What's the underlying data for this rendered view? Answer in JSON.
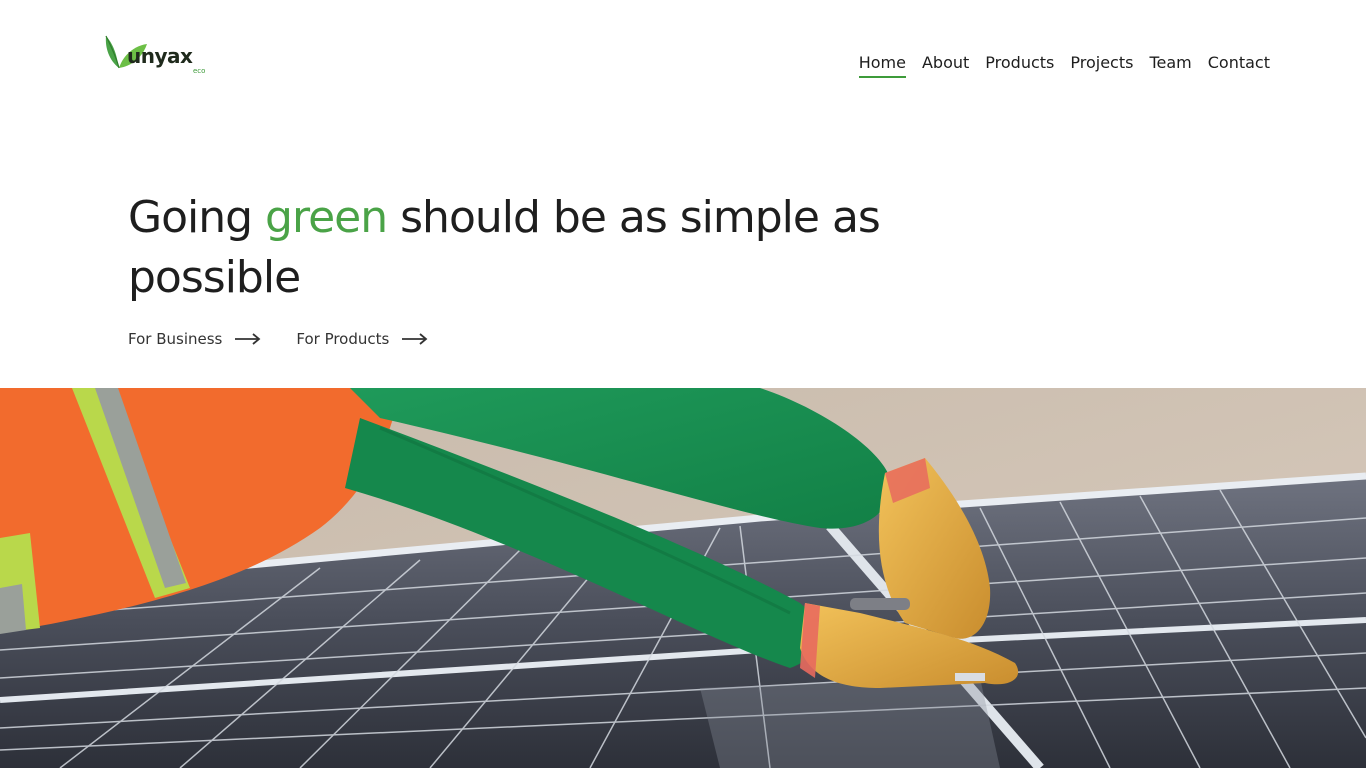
{
  "brand": {
    "name": "unyax",
    "sub": "eco",
    "colors": {
      "primary": "#4aa347",
      "text": "#1e1e1e"
    }
  },
  "nav": {
    "items": [
      {
        "label": "Home",
        "active": true
      },
      {
        "label": "About"
      },
      {
        "label": "Products"
      },
      {
        "label": "Projects"
      },
      {
        "label": "Team"
      },
      {
        "label": "Contact"
      }
    ]
  },
  "hero": {
    "headline_before": "Going ",
    "headline_highlight": "green",
    "headline_after": " should be as simple as possible",
    "cta_business": "For Business",
    "cta_products": "For Products",
    "arrow_icon": "arrow-right-icon"
  },
  "image": {
    "subject": "worker-with-gloves-installing-solar-panels"
  }
}
